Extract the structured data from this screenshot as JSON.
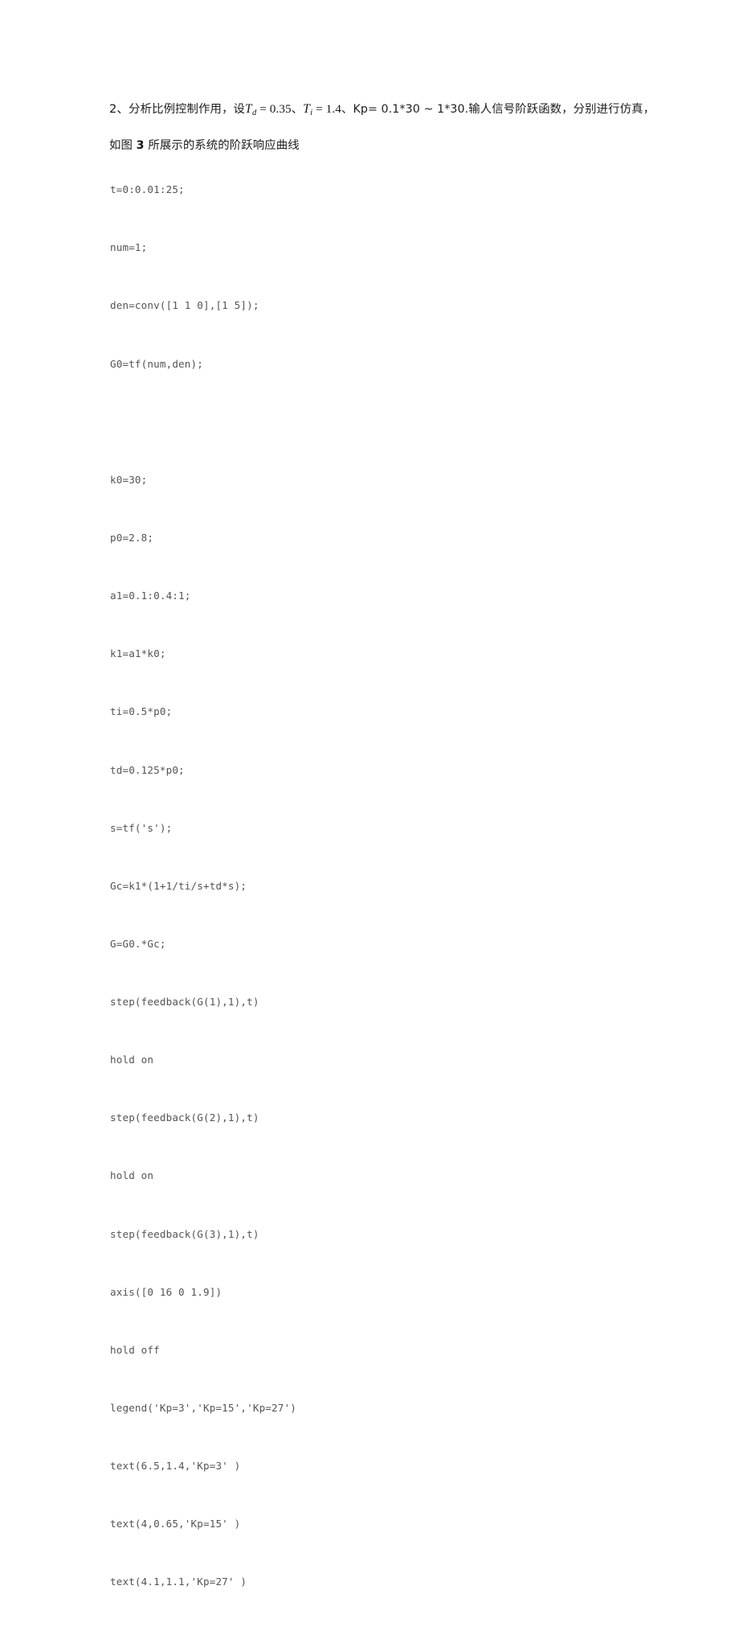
{
  "document": {
    "page_background": "#ffffff",
    "text_color": "#1d1d1d",
    "code_color": "#545454",
    "paragraph": {
      "item_number": "2、",
      "text_before_math": "分析比例控制作用，设",
      "math": [
        {
          "var": "T",
          "sub": "d",
          "relation": " = 0.35"
        },
        {
          "var": "T",
          "sub": "i",
          "relation": " = 1.4"
        }
      ],
      "separator": "、",
      "kp_label": "Kp=",
      "kp_range": " 0.1*30 ~ 1*30.",
      "text_after_kp": "输人信号阶跃函数，分别进行仿真，如图",
      "figure_number": "3",
      "text_tail": "所展示的系统的阶跃响应曲线",
      "line1_full": "2、分析比例控制作用，设 Td = 0.35 、 Ti = 1.4 、 Kp= 0.1*30 ~ 1*30.输人信号阶跃函",
      "line2_full": "数，分别进行仿真，如图 3 所展示的系统的阶跃响应曲线"
    },
    "code": {
      "language": "MATLAB",
      "lines": [
        "t=0:0.01:25;",
        "num=1;",
        "den=conv([1 1 0],[1 5]);",
        "G0=tf(num,den);",
        "",
        "k0=30;",
        "p0=2.8;",
        "a1=0.1:0.4:1;",
        "k1=a1*k0;",
        "ti=0.5*p0;",
        "td=0.125*p0;",
        "s=tf('s');",
        "Gc=k1*(1+1/ti/s+td*s);",
        "G=G0.*Gc;",
        "step(feedback(G(1),1),t)",
        "hold on",
        "step(feedback(G(2),1),t)",
        "hold on",
        "step(feedback(G(3),1),t)",
        "axis([0 16 0 1.9])",
        "hold off",
        "legend('Kp=3','Kp=15','Kp=27')",
        "text(6.5,1.4,'Kp=3' )",
        "text(4,0.65,'Kp=15' )",
        "text(4.1,1.1,'Kp=27' )"
      ]
    }
  }
}
